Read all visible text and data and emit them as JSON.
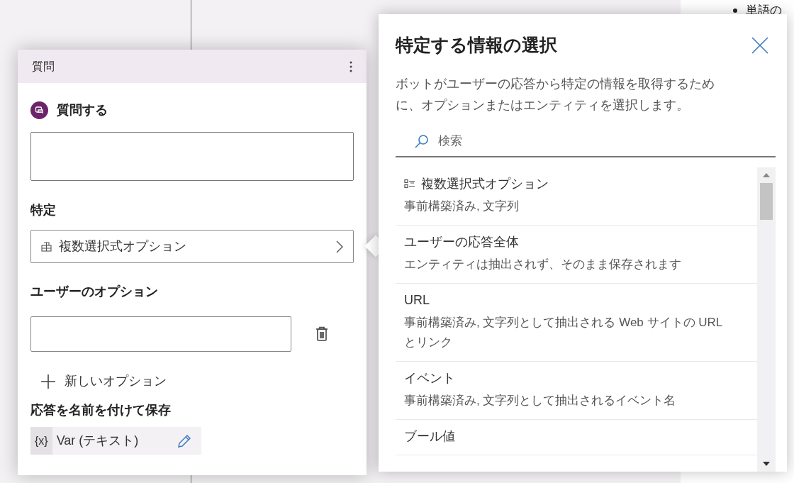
{
  "background_doc": {
    "bullet_text": "単語の"
  },
  "question_node": {
    "title": "質問",
    "section_title": "質問する",
    "identify_label": "特定",
    "identify_value": "複数選択式オプション",
    "options_label": "ユーザーのオプション",
    "add_option": "新しいオプション",
    "save_label": "応答を名前を付けて保存",
    "variable_prefix": "{x}",
    "variable": "Var (テキスト)"
  },
  "picker": {
    "title": "特定する情報の選択",
    "description": "ボットがユーザーの応答から特定の情報を取得するために、オプションまたはエンティティを選択します。",
    "search": {
      "placeholder": "検索"
    },
    "items": [
      {
        "kind": "options",
        "title": "複数選択式オプション",
        "subtitle": "事前構築済み, 文字列"
      },
      {
        "kind": "plain",
        "title": "ユーザーの応答全体",
        "subtitle": "エンティティは抽出されず、そのまま保存されます"
      },
      {
        "kind": "plain",
        "title": "URL",
        "subtitle": "事前構築済み, 文字列として抽出される Web サイトの URL とリンク"
      },
      {
        "kind": "plain",
        "title": "イベント",
        "subtitle": "事前構築済み, 文字列として抽出されるイベント名"
      },
      {
        "kind": "plain",
        "title": "ブール値"
      }
    ]
  }
}
